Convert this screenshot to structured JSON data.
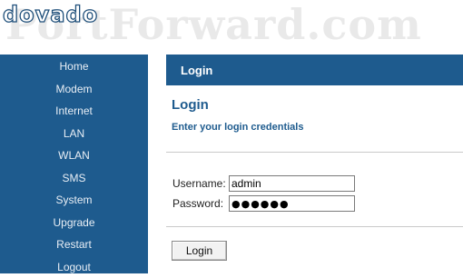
{
  "brand": {
    "logo_text": "dovado",
    "watermark_text": "PortForward.com"
  },
  "sidebar": {
    "items": [
      {
        "label": "Home"
      },
      {
        "label": "Modem"
      },
      {
        "label": "Internet"
      },
      {
        "label": "LAN"
      },
      {
        "label": "WLAN"
      },
      {
        "label": "SMS"
      },
      {
        "label": "System"
      },
      {
        "label": "Upgrade"
      },
      {
        "label": "Restart"
      },
      {
        "label": "Logout"
      }
    ]
  },
  "panel": {
    "header_title": "Login",
    "title": "Login",
    "subtitle": "Enter your login credentials"
  },
  "form": {
    "username_label": "Username:",
    "username_value": "admin",
    "password_label": "Password:",
    "password_value": "●●●●●●",
    "submit_label": "Login"
  },
  "colors": {
    "sidebar_bg": "#1e5b8e",
    "accent_text": "#1e5b8e",
    "page_bg": "#ffffff"
  }
}
